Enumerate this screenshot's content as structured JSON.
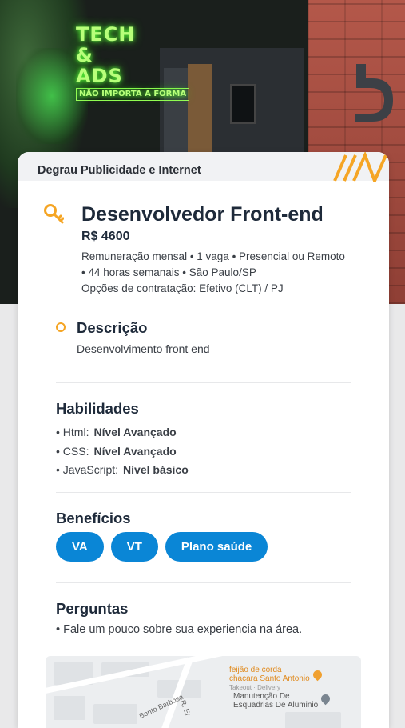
{
  "hero": {
    "neon_line1": "TECH",
    "neon_line2": "&",
    "neon_line3": "ADS",
    "neon_sub": "NÃO IMPORTA A FORMA"
  },
  "card": {
    "company": "Degrau Publicidade e Internet",
    "job": {
      "title": "Desenvolvedor Front-end",
      "salary": "R$ 4600",
      "meta_line1": "Remuneração mensal • 1 vaga • Presencial ou Remoto",
      "meta_line2": "• 44 horas semanais • São Paulo/SP",
      "meta_line3": "Opções de contratação: Efetivo (CLT) / PJ"
    },
    "description": {
      "title": "Descrição",
      "text": "Desenvolvimento front end"
    },
    "skills": {
      "title": "Habilidades",
      "items": [
        {
          "name": "• Html:",
          "level": "Nível Avançado"
        },
        {
          "name": "• CSS:",
          "level": "Nível Avançado"
        },
        {
          "name": "• JavaScript:",
          "level": "Nível básico"
        }
      ]
    },
    "benefits": {
      "title": "Benefícios",
      "items": [
        "VA",
        "VT",
        "Plano saúde"
      ]
    },
    "questions": {
      "title": "Perguntas",
      "items": [
        "• Fale um pouco sobre sua experiencia na área."
      ]
    },
    "map": {
      "poi1_line1": "feijão de corda",
      "poi1_line2": "chacara Santo Antonio",
      "poi1_line3": "Takeout · Delivery",
      "poi2_line1": "Manutenção De",
      "poi2_line2": "Esquadrias De Aluminio",
      "street1": "Bento Barbosa",
      "street2": "R. Er"
    }
  },
  "colors": {
    "accent_orange": "#f5a524",
    "pill_blue": "#0a86d6",
    "title_navy": "#1e2a3a"
  }
}
